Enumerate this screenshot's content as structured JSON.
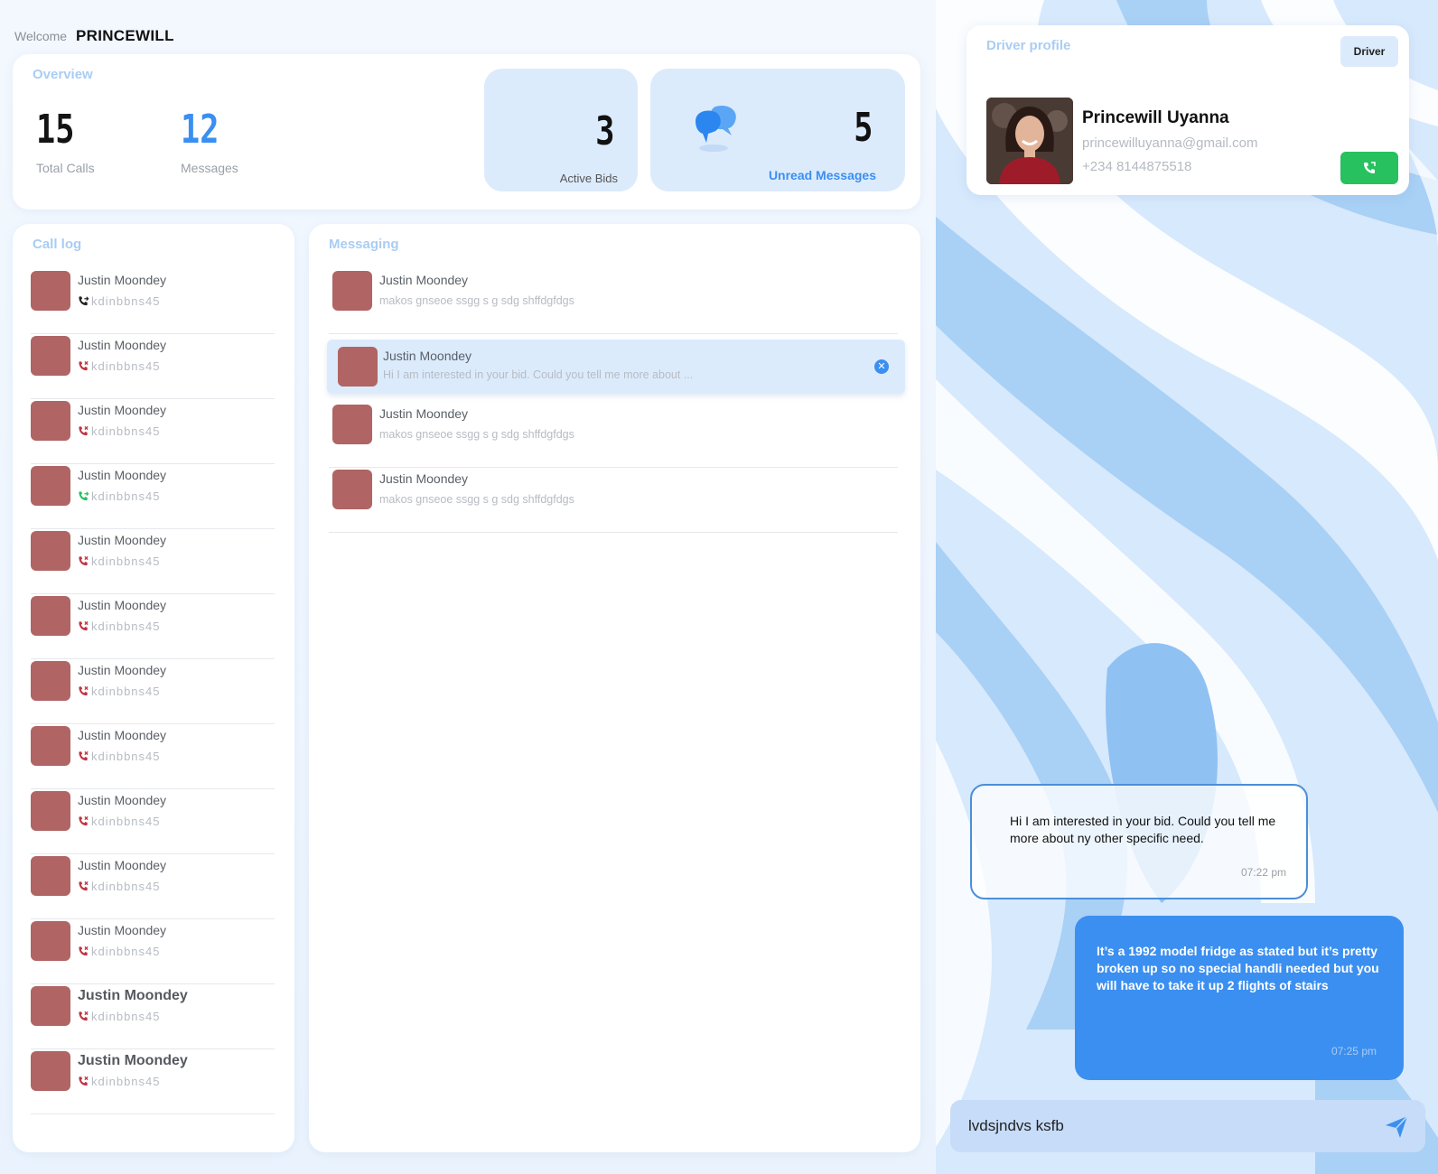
{
  "header": {
    "welcome_label": "Welcome",
    "user_name": "PRINCEWILL"
  },
  "overview": {
    "title": "Overview",
    "total_calls": {
      "value": "15",
      "label": "Total Calls"
    },
    "messages": {
      "value": "12",
      "label": "Messages"
    },
    "active_bids": {
      "value": "3",
      "label": "Active Bids"
    },
    "unread_messages": {
      "value": "5",
      "label": "Unread Messages"
    }
  },
  "call_log": {
    "title": "Call log",
    "items": [
      {
        "name": "Justin Moondey",
        "id": "kdinbbns45",
        "status": "outgoing"
      },
      {
        "name": "Justin Moondey",
        "id": "kdinbbns45",
        "status": "missed"
      },
      {
        "name": "Justin Moondey",
        "id": "kdinbbns45",
        "status": "missed"
      },
      {
        "name": "Justin Moondey",
        "id": "kdinbbns45",
        "status": "incoming"
      },
      {
        "name": "Justin Moondey",
        "id": "kdinbbns45",
        "status": "missed"
      },
      {
        "name": "Justin Moondey",
        "id": "kdinbbns45",
        "status": "missed"
      },
      {
        "name": "Justin Moondey",
        "id": "kdinbbns45",
        "status": "missed"
      },
      {
        "name": "Justin Moondey",
        "id": "kdinbbns45",
        "status": "missed"
      },
      {
        "name": "Justin Moondey",
        "id": "kdinbbns45",
        "status": "missed"
      },
      {
        "name": "Justin Moondey",
        "id": "kdinbbns45",
        "status": "missed"
      },
      {
        "name": "Justin Moondey",
        "id": "kdinbbns45",
        "status": "missed"
      },
      {
        "name": "Justin Moondey",
        "id": "kdinbbns45",
        "status": "missed"
      },
      {
        "name": "Justin Moondey",
        "id": "kdinbbns45",
        "status": "missed"
      }
    ]
  },
  "messaging": {
    "title": "Messaging",
    "items": [
      {
        "name": "Justin Moondey",
        "preview": "makos gnseoe ssgg s g sdg shffdgfdgs"
      },
      {
        "name": "Justin Moondey",
        "preview": "Hi I am interested in your bid. Could you tell me more about ..."
      },
      {
        "name": "Justin Moondey",
        "preview": "makos gnseoe ssgg s g sdg shffdgfdgs"
      },
      {
        "name": "Justin Moondey",
        "preview": "makos gnseoe ssgg s g sdg shffdgfdgs"
      }
    ]
  },
  "profile": {
    "title": "Driver profile",
    "role": "Driver",
    "name": "Princewill Uyanna",
    "email": "princewilluyanna@gmail.com",
    "phone": "+234 8144875518"
  },
  "chat": {
    "incoming": {
      "text": "Hi I am interested in your bid. Could you tell me more about ny other specific need.",
      "time": "07:22 pm"
    },
    "outgoing": {
      "text": "It’s a 1992 model fridge as stated but it’s pretty broken up so no special handli needed but you will have to take it up 2 flights of stairs",
      "time": "07:25 pm"
    },
    "composer_value": "lvdsjndvs ksfb"
  },
  "colors": {
    "accent": "#3b8ff0",
    "tile": "#dcebfc",
    "avatar": "#b06464",
    "missed": "#c0343f",
    "incoming": "#27c15f",
    "call_button": "#27c15f"
  }
}
